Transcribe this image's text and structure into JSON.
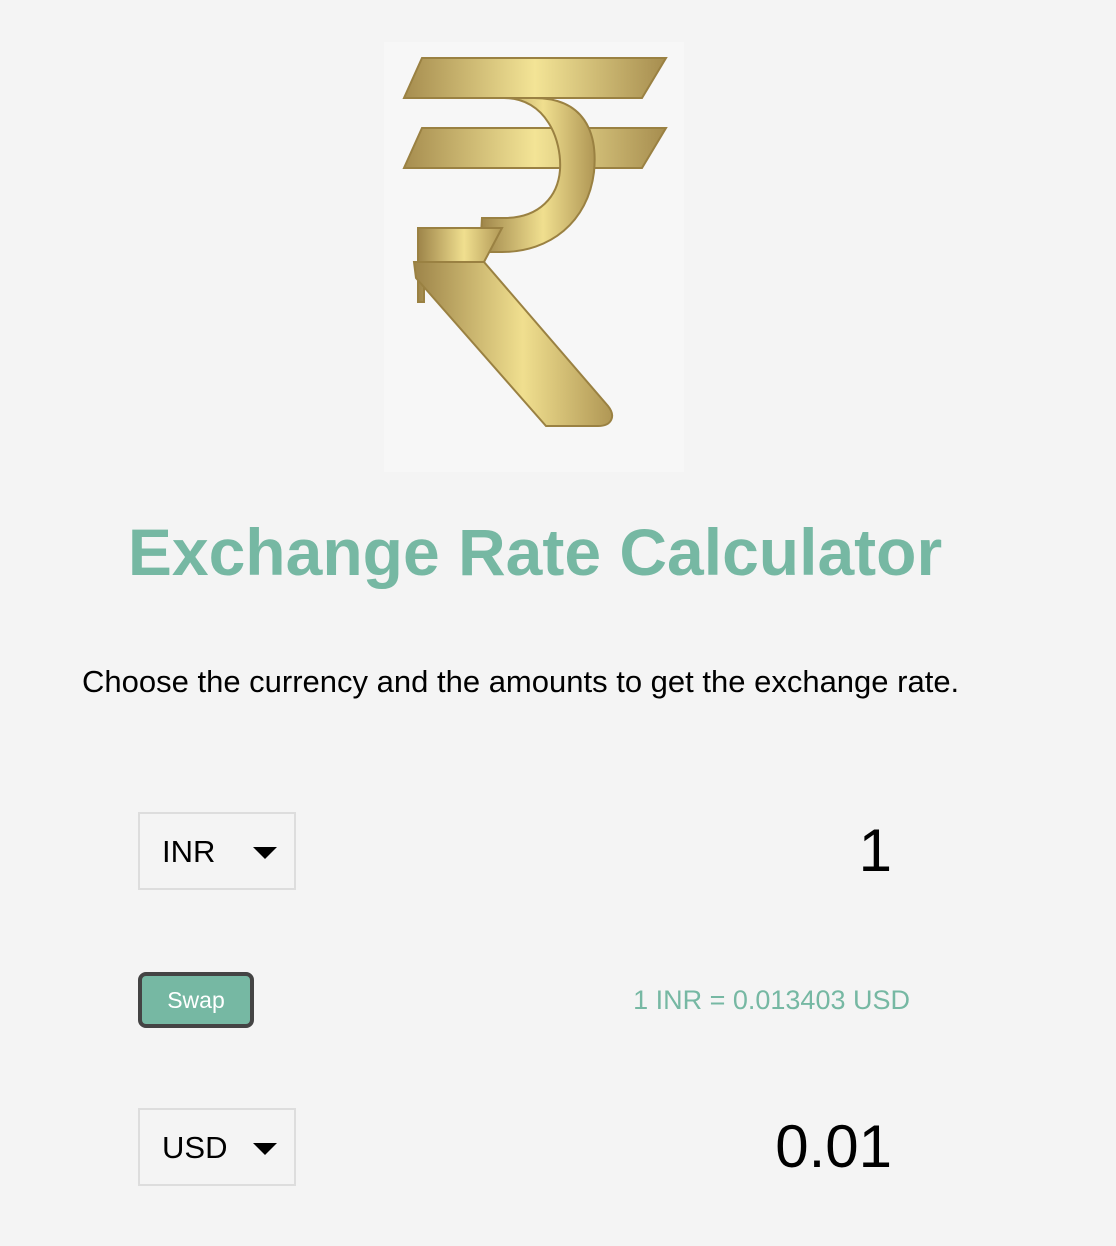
{
  "header": {
    "logo": {
      "icon": "rupee-icon",
      "colors": {
        "gold_light": "#f3e496",
        "gold_mid": "#d9c16d",
        "gold_dark": "#a68d4f",
        "background": "#f7f7f7"
      }
    },
    "title": "Exchange Rate Calculator",
    "subtitle": "Choose the currency and the amounts to get the exchange rate."
  },
  "converter": {
    "currency_one": {
      "selected": "INR",
      "amount": "1"
    },
    "swap_label": "Swap",
    "rate_text": "1 INR = 0.013403 USD",
    "currency_two": {
      "selected": "USD",
      "amount": "0.01"
    }
  },
  "colors": {
    "accent": "#76b8a3",
    "page_background": "#f4f4f4",
    "text": "#000000"
  }
}
